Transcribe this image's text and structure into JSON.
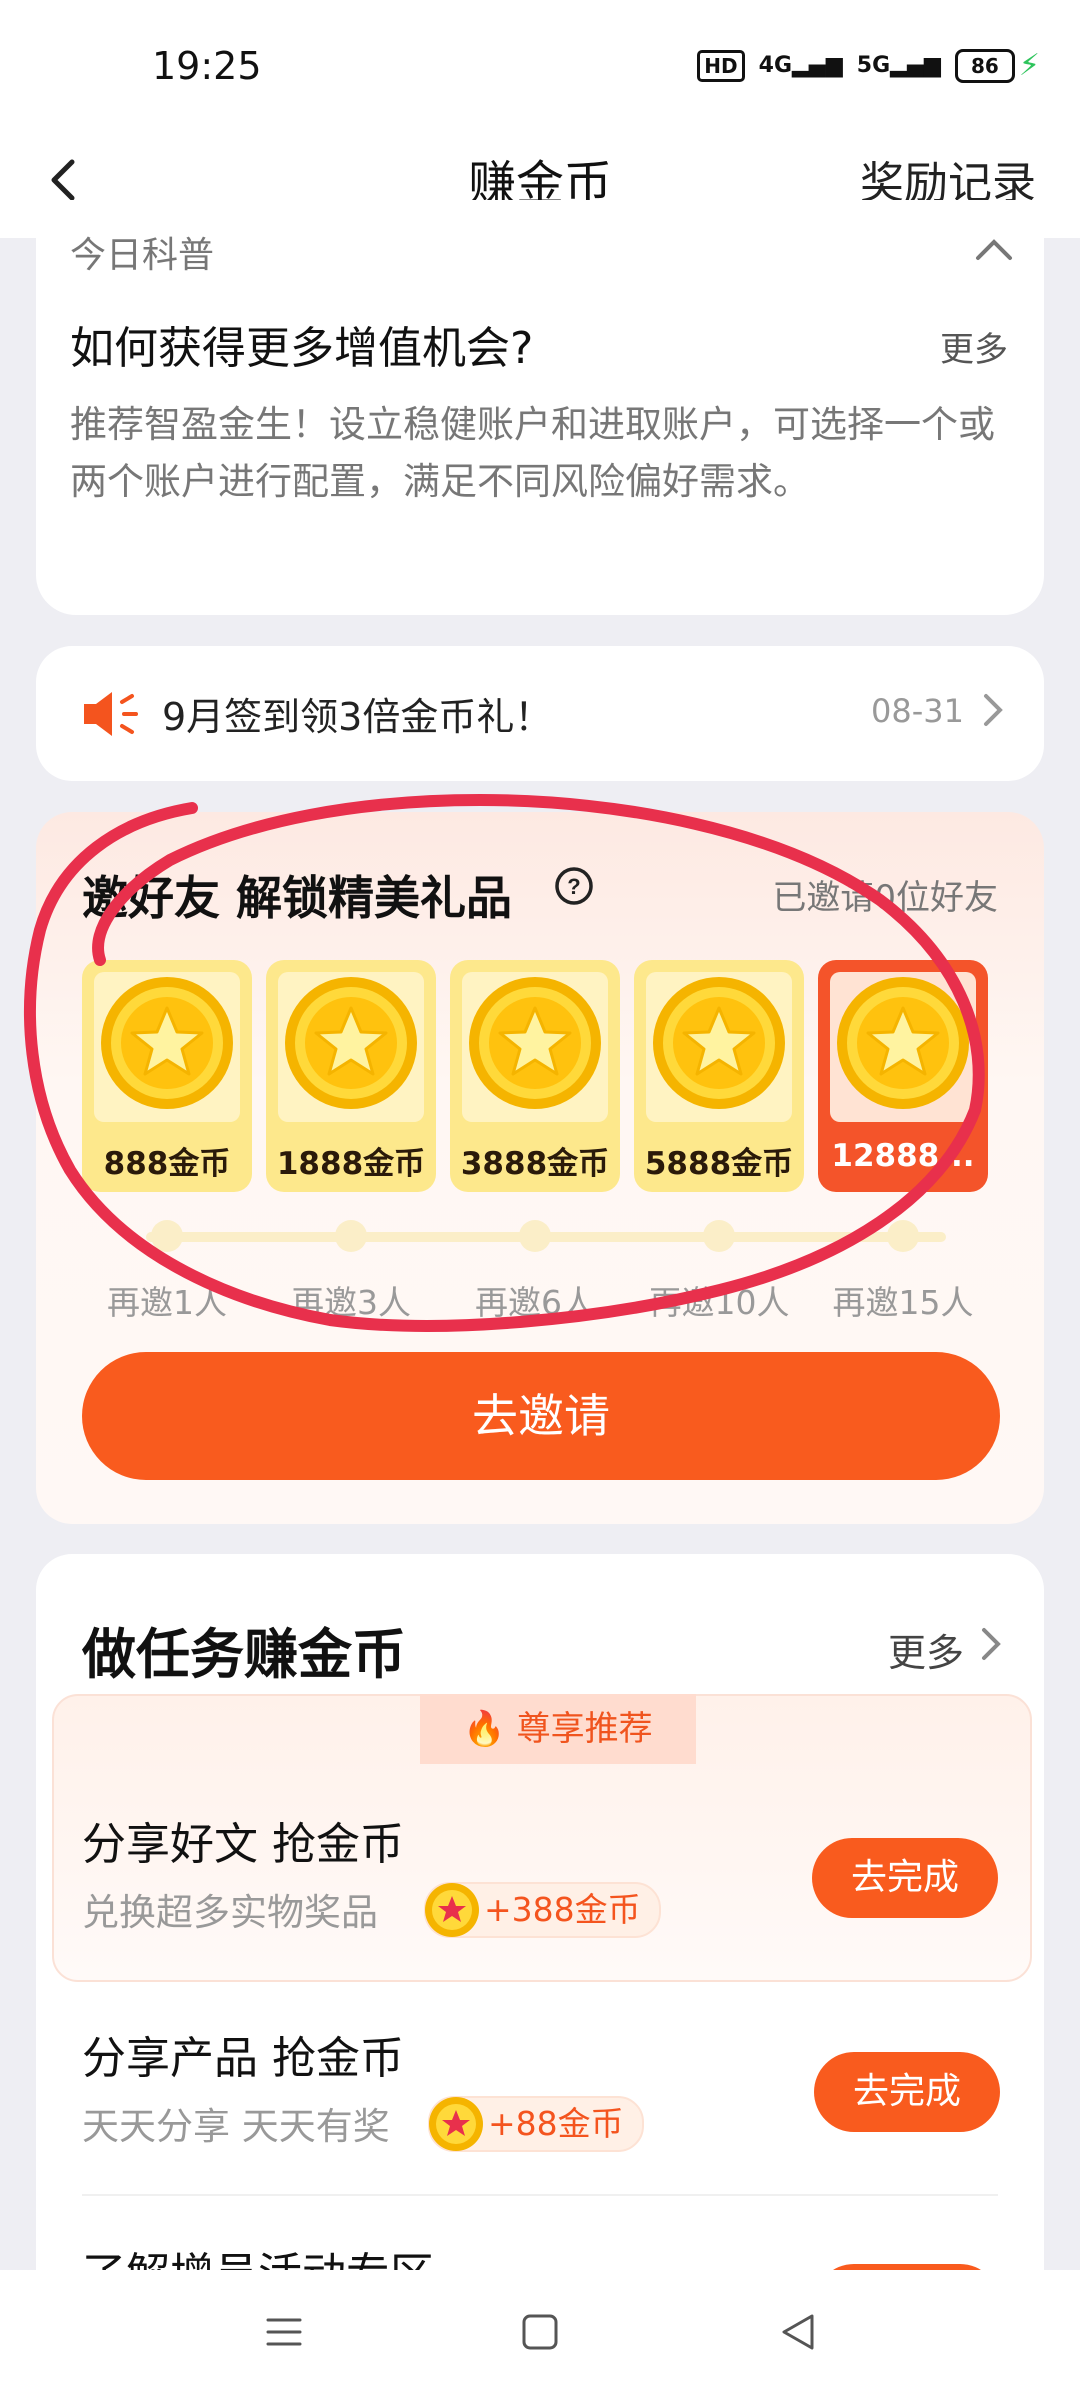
{
  "status": {
    "time": "19:25",
    "hd": "HD",
    "net1": "4G",
    "net2": "5G",
    "battery": "86"
  },
  "nav": {
    "title": "赚金币",
    "right": "奖励记录"
  },
  "science": {
    "label": "今日科普",
    "title": "如何获得更多增值机会?",
    "more": "更多",
    "body": "推荐智盈金生！设立稳健账户和进取账户，可选择一个或两个账户进行配置，满足不同风险偏好需求。"
  },
  "notice": {
    "text": "9月签到领3倍金币礼！",
    "date": "08-31"
  },
  "invite": {
    "title": "邀好友 解锁精美礼品",
    "invited": "已邀请0位好友",
    "gifts": [
      {
        "label": "888金币"
      },
      {
        "label": "1888金币"
      },
      {
        "label": "3888金币"
      },
      {
        "label": "5888金币"
      },
      {
        "label": "12888..."
      }
    ],
    "steps": [
      "再邀1人",
      "再邀3人",
      "再邀6人",
      "再邀10人",
      "再邀15人"
    ],
    "button": "去邀请"
  },
  "tasks": {
    "title": "做任务赚金币",
    "more": "更多",
    "recommend_tag": "尊享推荐",
    "items": [
      {
        "name": "分享好文 抢金币",
        "desc": "兑换超多实物奖品",
        "reward": "+388金币",
        "button": "去完成"
      },
      {
        "name": "分享产品 抢金币",
        "desc": "天天分享 天天有奖",
        "reward": "+88金币",
        "button": "去完成"
      },
      {
        "name": "了解增员活动专区"
      }
    ]
  },
  "colors": {
    "accent": "#f95b1e",
    "annotation": "#e8304c",
    "gold": "#fde88c"
  }
}
